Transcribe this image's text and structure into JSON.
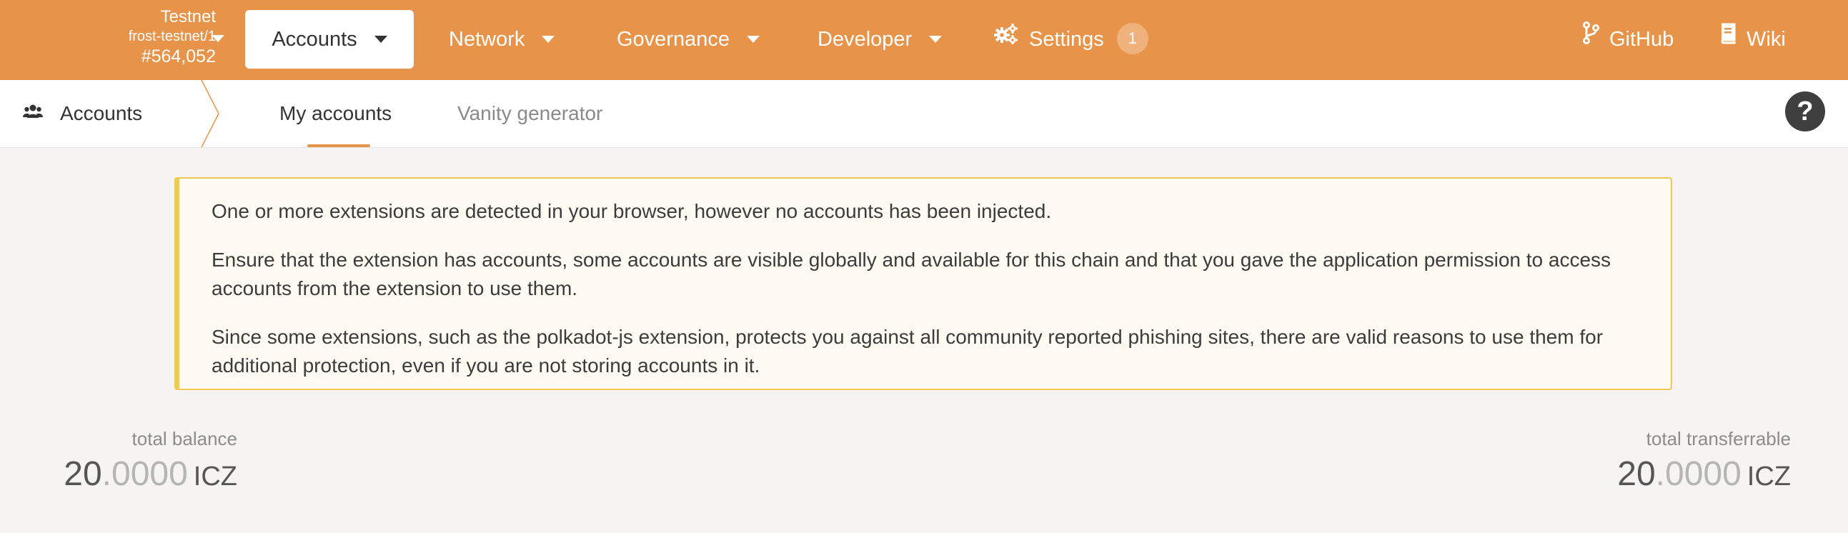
{
  "chain": {
    "network": "Testnet",
    "name": "frost-testnet/1",
    "block": "#564,052"
  },
  "nav": {
    "accounts": "Accounts",
    "network": "Network",
    "governance": "Governance",
    "developer": "Developer",
    "settings": "Settings",
    "settings_badge": "1",
    "github": "GitHub",
    "wiki": "Wiki"
  },
  "subnav": {
    "section": "Accounts",
    "tabs": [
      "My accounts",
      "Vanity generator"
    ],
    "help": "?"
  },
  "warning": {
    "paragraphs": [
      "One or more extensions are detected in your browser, however no accounts has been injected.",
      "Ensure that the extension has accounts, some accounts are visible globally and available for this chain and that you gave the application permission to access accounts from the extension to use them.",
      "Since some extensions, such as the polkadot-js extension, protects you against all community reported phishing sites, there are valid reasons to use them for additional protection, even if you are not storing accounts in it."
    ]
  },
  "totals": {
    "balance": {
      "label": "total balance",
      "integer": "20",
      "decimal": ".0000",
      "unit": "ICZ"
    },
    "transferrable": {
      "label": "total transferrable",
      "integer": "20",
      "decimal": ".0000",
      "unit": "ICZ"
    }
  },
  "colors": {
    "brand": "#e7944a",
    "warning_border": "#f0c85a",
    "warning_bg": "#fffaf2"
  }
}
